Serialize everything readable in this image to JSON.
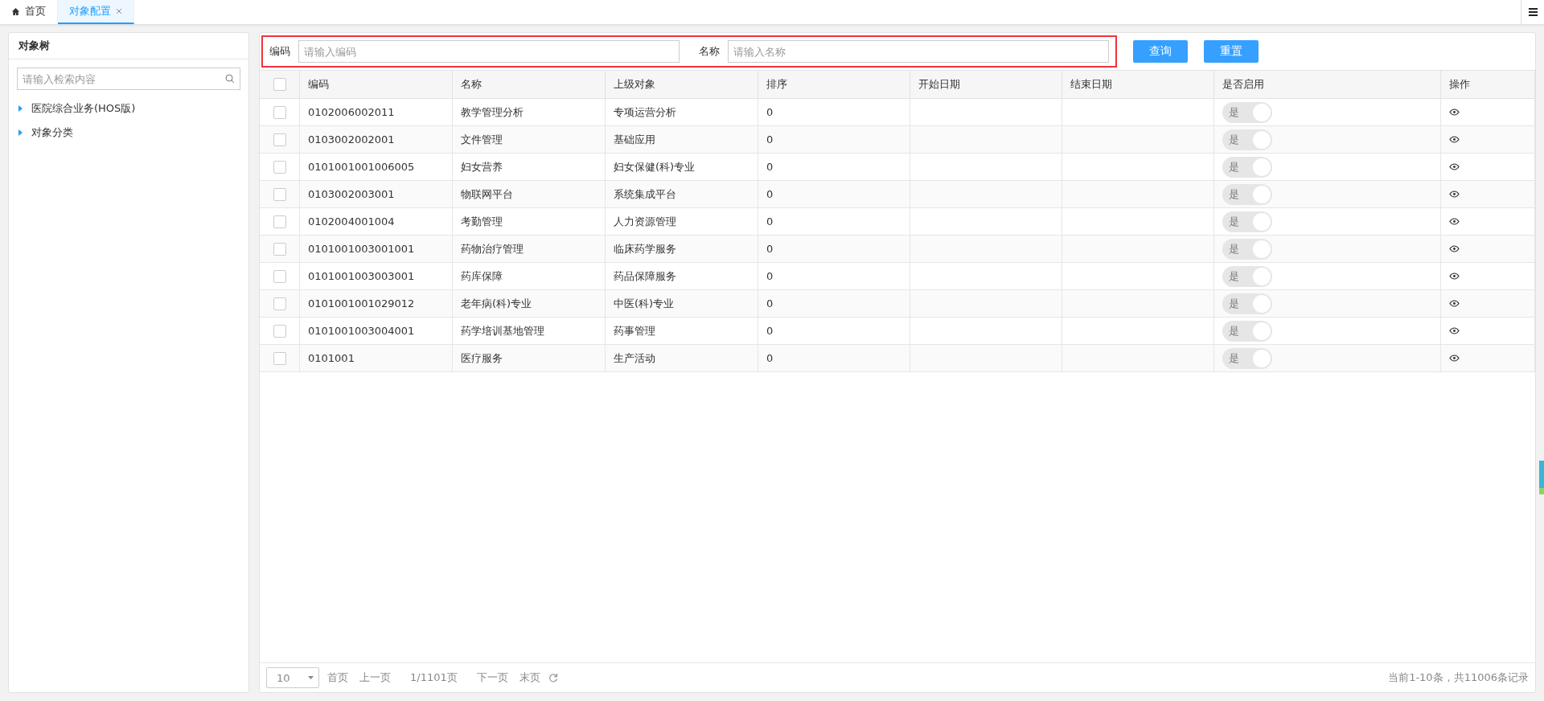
{
  "tabs": [
    {
      "label": "首页",
      "kind": "home",
      "selected": false
    },
    {
      "label": "对象配置",
      "kind": "closable",
      "selected": true
    }
  ],
  "sidebar": {
    "title": "对象树",
    "search_placeholder": "请输入检索内容",
    "items": [
      {
        "label": "医院综合业务(HOS版)",
        "expanded": false
      },
      {
        "label": "对象分类",
        "expanded": false
      }
    ]
  },
  "filters": [
    {
      "label": "编码",
      "placeholder": "请输入编码"
    },
    {
      "label": "名称",
      "placeholder": "请输入名称"
    }
  ],
  "buttons": [
    "查询",
    "重置"
  ],
  "table": {
    "select_all": false,
    "columns": [
      "编码",
      "名称",
      "上级对象",
      "排序",
      "开始日期",
      "结束日期",
      "是否启用",
      "操作"
    ],
    "rows": [
      {
        "checked": false,
        "code": "0102006002011",
        "name": "教学管理分析",
        "parent": "专项运营分析",
        "sort": "0",
        "toggle_label": "是",
        "enabled": true
      },
      {
        "checked": false,
        "code": "0103002002001",
        "name": "文件管理",
        "parent": "基础应用",
        "sort": "0",
        "toggle_label": "是",
        "enabled": true
      },
      {
        "checked": false,
        "code": "0101001001006005",
        "name": "妇女营养",
        "parent": "妇女保健(科)专业",
        "sort": "0",
        "toggle_label": "是",
        "enabled": true
      },
      {
        "checked": false,
        "code": "0103002003001",
        "name": "物联网平台",
        "parent": "系统集成平台",
        "sort": "0",
        "toggle_label": "是",
        "enabled": true
      },
      {
        "checked": false,
        "code": "0102004001004",
        "name": "考勤管理",
        "parent": "人力资源管理",
        "sort": "0",
        "toggle_label": "是",
        "enabled": true
      },
      {
        "checked": false,
        "code": "0101001003001001",
        "name": "药物治疗管理",
        "parent": "临床药学服务",
        "sort": "0",
        "toggle_label": "是",
        "enabled": true
      },
      {
        "checked": false,
        "code": "0101001003003001",
        "name": "药库保障",
        "parent": "药品保障服务",
        "sort": "0",
        "toggle_label": "是",
        "enabled": true
      },
      {
        "checked": false,
        "code": "0101001001029012",
        "name": "老年病(科)专业",
        "parent": "中医(科)专业",
        "sort": "0",
        "toggle_label": "是",
        "enabled": true
      },
      {
        "checked": false,
        "code": "0101001003004001",
        "name": "药学培训基地管理",
        "parent": "药事管理",
        "sort": "0",
        "toggle_label": "是",
        "enabled": true
      },
      {
        "checked": false,
        "code": "0101001",
        "name": "医疗服务",
        "parent": "生产活动",
        "sort": "0",
        "toggle_label": "是",
        "enabled": true
      }
    ]
  },
  "pagination": {
    "page_size": "10",
    "first": "首页",
    "prev": "上一页",
    "page": "1/1101页",
    "next": "下一页",
    "last": "末页",
    "summary": "当前1-10条，共11006条记录"
  }
}
